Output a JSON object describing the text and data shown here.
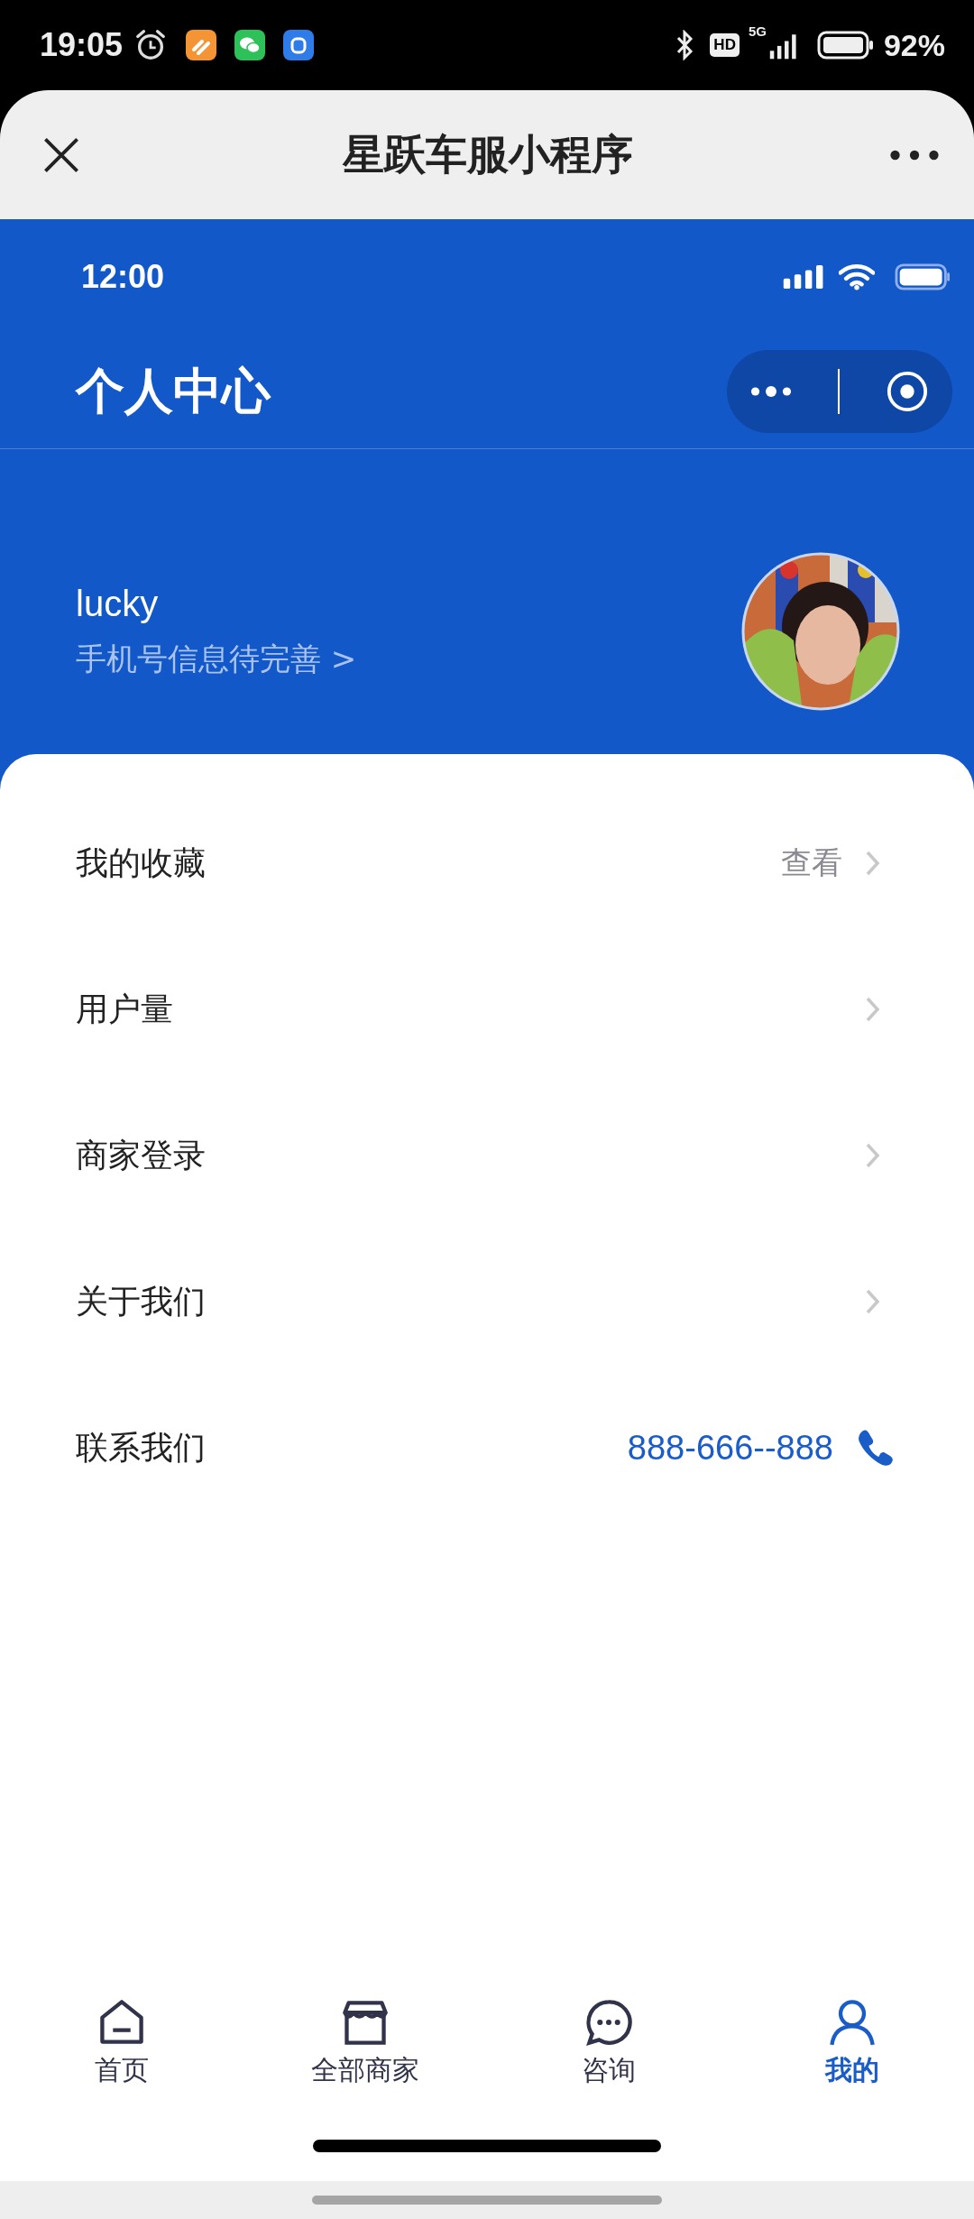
{
  "phone_status": {
    "time": "19:05",
    "hd": "HD",
    "network": "5G",
    "battery": "92%"
  },
  "wechat_header": {
    "title": "星跃车服小程序"
  },
  "page_status": {
    "time": "12:00"
  },
  "nav": {
    "title": "个人中心"
  },
  "profile": {
    "name": "lucky",
    "phone_hint": "手机号信息待完善 >"
  },
  "menu": [
    {
      "label": "我的收藏",
      "kind": "link",
      "value": "查看"
    },
    {
      "label": "用户量",
      "kind": "link"
    },
    {
      "label": "商家登录",
      "kind": "link"
    },
    {
      "label": "关于我们",
      "kind": "link"
    },
    {
      "label": "联系我们",
      "kind": "phone",
      "value": "888-666--888"
    }
  ],
  "tabs": [
    {
      "label": "首页",
      "selected": false
    },
    {
      "label": "全部商家",
      "selected": false
    },
    {
      "label": "咨询",
      "selected": false
    },
    {
      "label": "我的",
      "selected": true
    }
  ]
}
